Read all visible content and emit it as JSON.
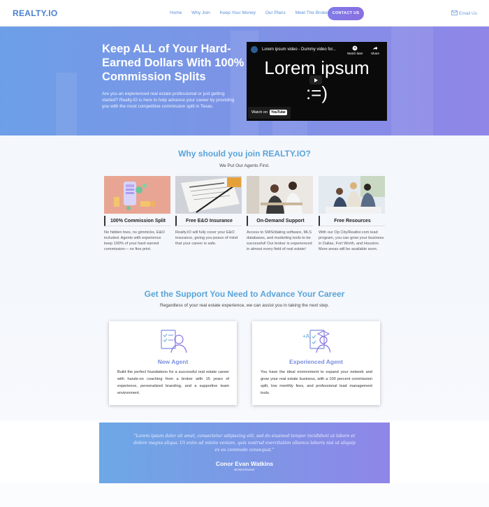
{
  "header": {
    "logo": "REALTY.IO",
    "nav": [
      "Home",
      "Why Join",
      "Keep Your Money",
      "Our Plans",
      "Meet The Broker/Owner"
    ],
    "contact_button": "CONTACT US",
    "email_link": "Email Us"
  },
  "hero": {
    "title": "Keep ALL of Your Hard-Earned Dollars With 100% Commission Splits",
    "text": "Are you an experienced real estate professional or just getting started? Realty.IO is here to help advance your career by providing you with the most competitive commission split in Texas.",
    "video": {
      "title": "Lorem ipsum video - Dummy video for...",
      "watch_later": "Watch later",
      "share": "Share",
      "big_text_line1": "Lorem ipsum",
      "big_text_line2": ":=)",
      "watch_on": "Watch on",
      "youtube": "YouTube"
    }
  },
  "why": {
    "title": "Why should you join REALTY.IO?",
    "subtitle": "We Put Our Agents First.",
    "cards": [
      {
        "title": "100% Commission Split",
        "text": "No hidden fees, no gimmicks, E&O included. Agents with experience keep 100% of your hard earned commission— no fine print."
      },
      {
        "title": "Free E&O Insurance",
        "text": "Realty.IO will fully cover your E&O insurance, giving you peace of mind that your career is safe."
      },
      {
        "title": "On-Demand Support",
        "text": "Access to SMS/dialing software, MLS databases, and marketing tools to be successful! Our broker is experienced in almost every field of real estate!"
      },
      {
        "title": "Free Resources",
        "text": "With our Op City/Realtor.com lead program, you can grow your business in Dallas, Fort Worth, and Houston. More areas will be available soon."
      }
    ]
  },
  "support": {
    "title": "Get the Support You Need to Advance Your Career",
    "subtitle": "Regardless of your real estate experience, we can assist you in taking the next step.",
    "boxes": [
      {
        "title": "New Agent",
        "text": "Build the perfect foundations for a successful real estate career with hands-on coaching from a broker with 15 years of experience, personalized branding, and a supportive team environment."
      },
      {
        "title": "Experienced Agent",
        "text": "You have the ideal environment to expand your network and grow your real estate business, with a 100 percent commission split, low monthly fees, and professional lead management tools."
      }
    ]
  },
  "testimonial": {
    "quote": "\"Lorem ipsum dolor sit amet, consectetur adipiscing elit, sed do eiusmod tempor incididunt ut labore et dolore magna aliqua. Ut enim ad minim veniam, quis nostrud exercitation ullamco laboris nisi ut aliquip ex ea commodo consequat.\"",
    "name": "Conor Evan Watkins",
    "role": "Broker/Owner"
  },
  "colors": {
    "accent_blue": "#5aa4d8",
    "accent_purple": "#8a6fe0",
    "nav_text": "#5b8fd6"
  },
  "icons": [
    "house-roof-icon",
    "email-icon",
    "play-icon",
    "clock-icon",
    "share-icon",
    "agent-checklist-icon",
    "experienced-agent-icon"
  ]
}
